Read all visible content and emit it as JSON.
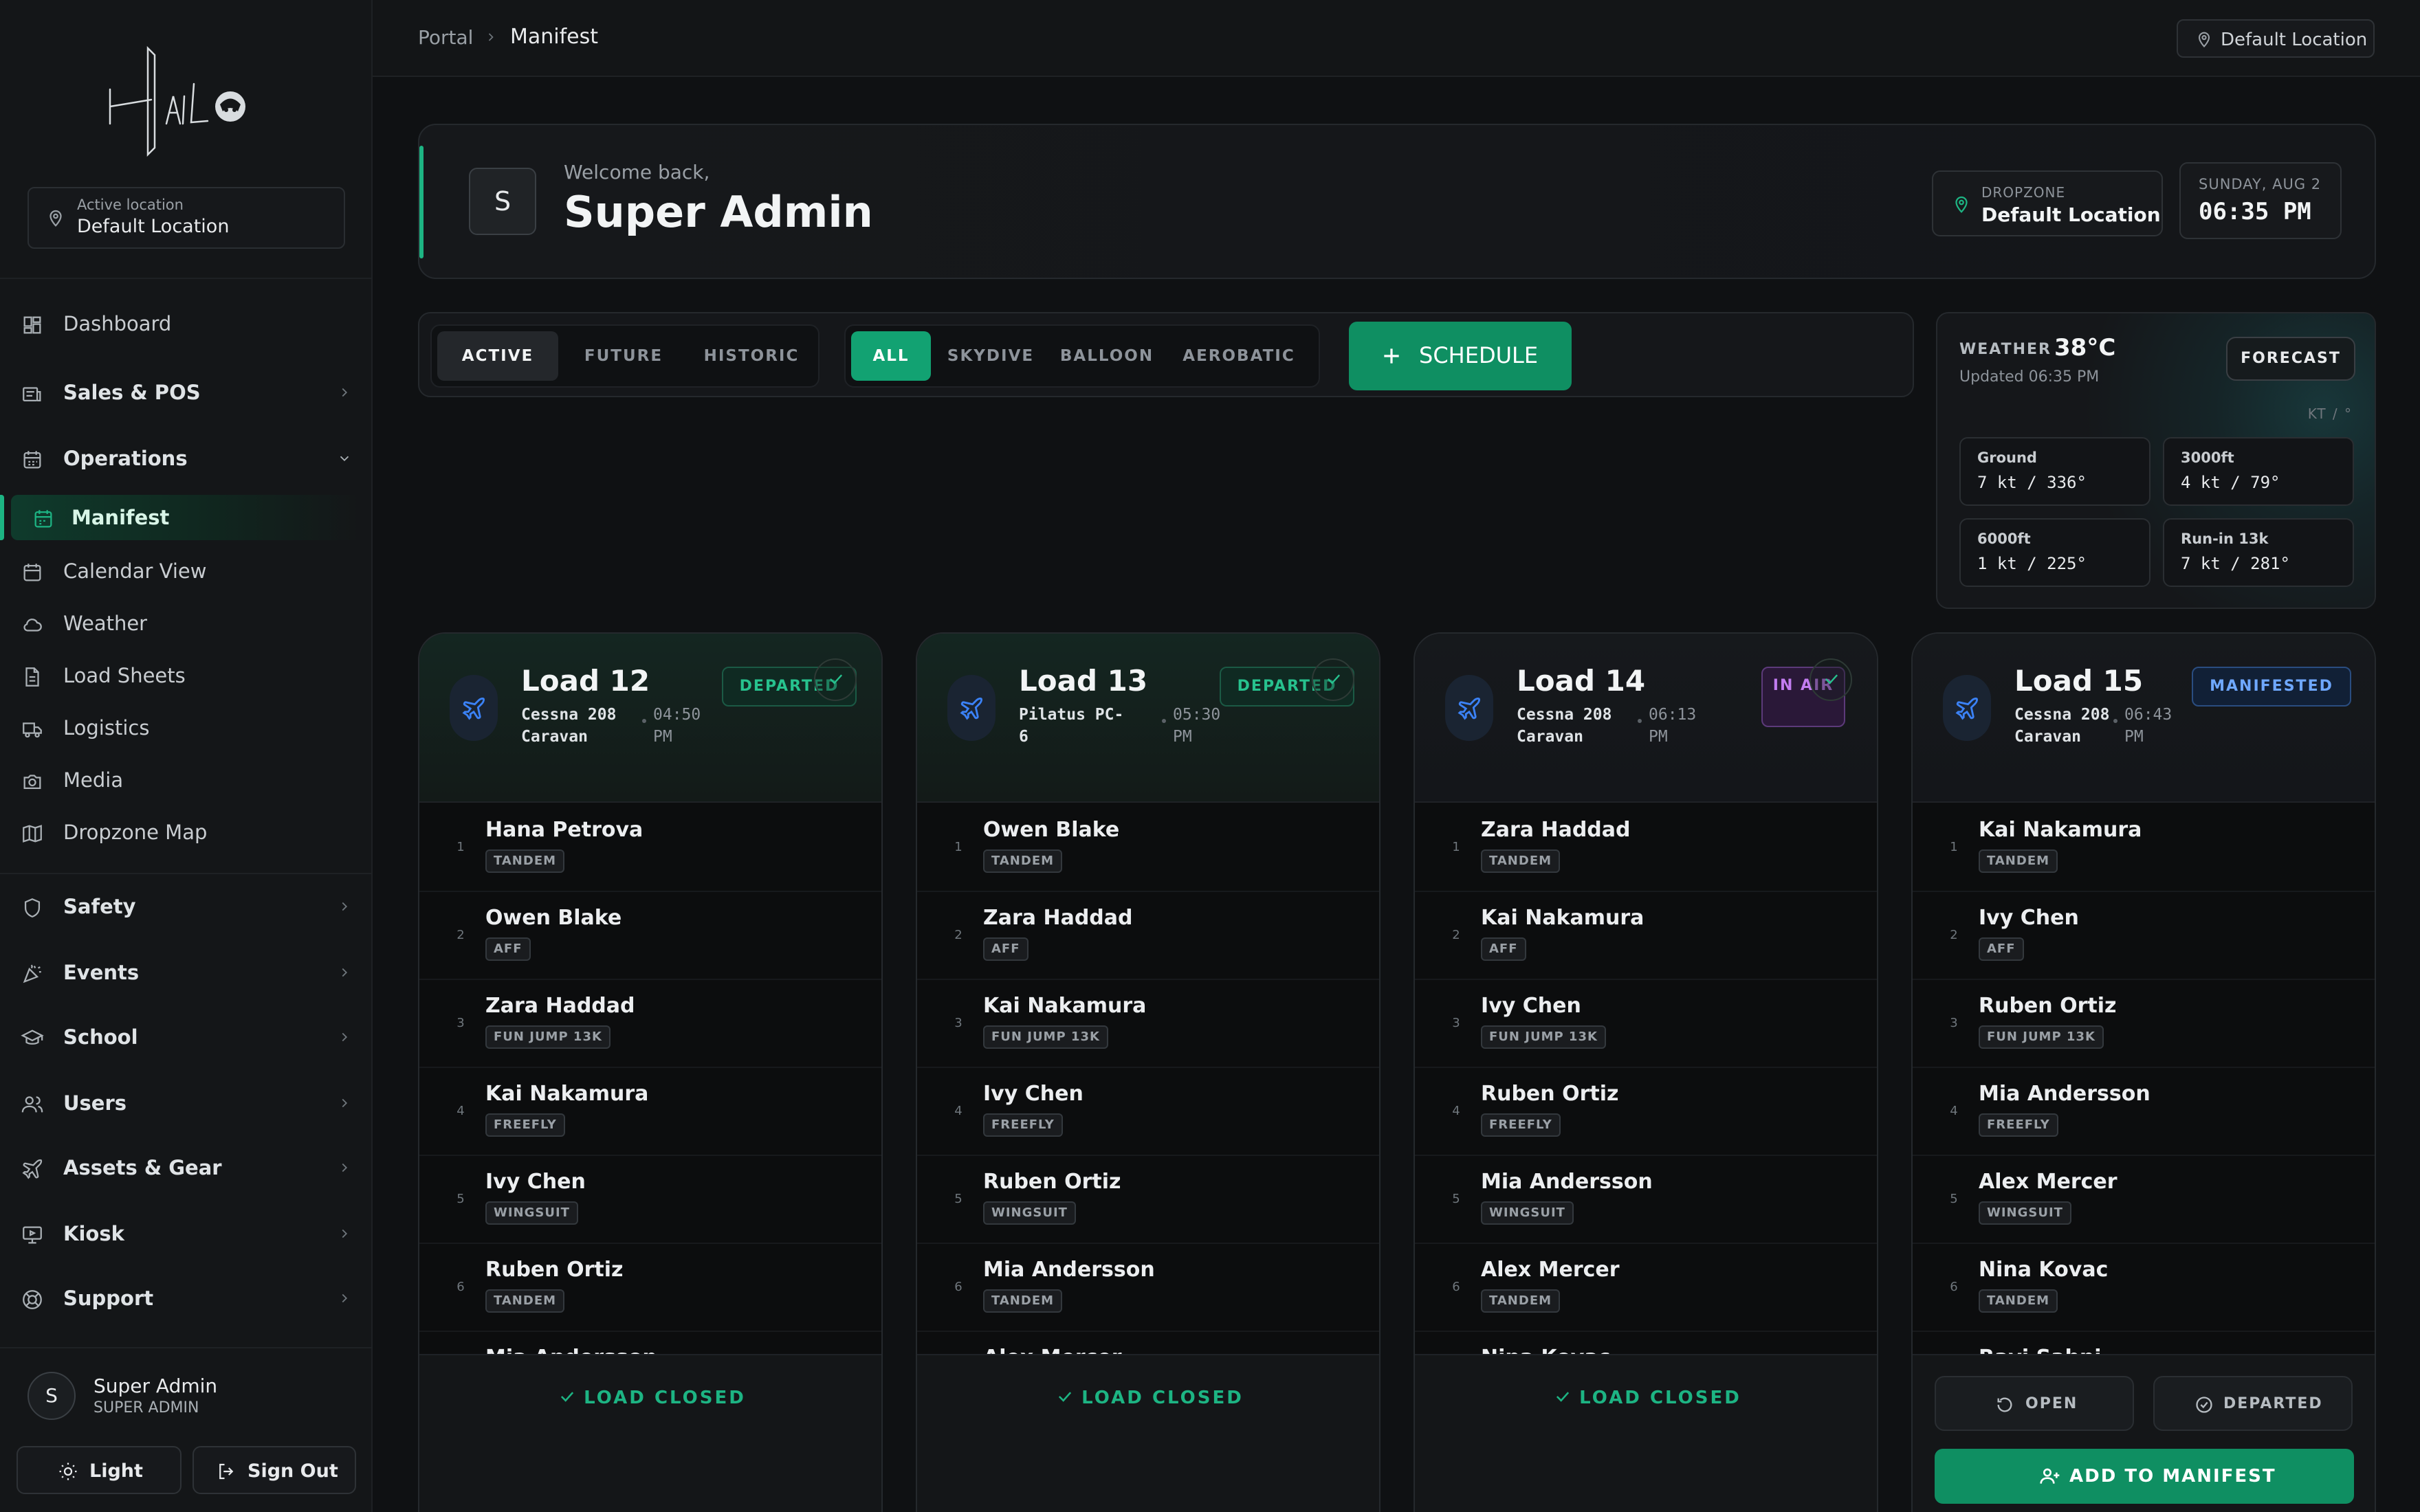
{
  "sidebar": {
    "active_location_label": "Active location",
    "active_location_value": "Default Location",
    "items": [
      {
        "label": "Dashboard",
        "icon": "dashboard-icon"
      },
      {
        "label": "Sales & POS",
        "icon": "receipt-icon"
      },
      {
        "label": "Operations",
        "icon": "calendar-icon"
      },
      {
        "label": "Manifest",
        "icon": "calendar-icon"
      },
      {
        "label": "Calendar View",
        "icon": "calendar-icon"
      },
      {
        "label": "Weather",
        "icon": "cloud-icon"
      },
      {
        "label": "Load Sheets",
        "icon": "document-icon"
      },
      {
        "label": "Logistics",
        "icon": "truck-icon"
      },
      {
        "label": "Media",
        "icon": "camera-icon"
      },
      {
        "label": "Dropzone Map",
        "icon": "map-icon"
      },
      {
        "label": "Safety",
        "icon": "shield-icon"
      },
      {
        "label": "Events",
        "icon": "party-icon"
      },
      {
        "label": "School",
        "icon": "graduation-cap-icon"
      },
      {
        "label": "Users",
        "icon": "users-icon"
      },
      {
        "label": "Assets & Gear",
        "icon": "plane-icon"
      },
      {
        "label": "Kiosk",
        "icon": "monitor-icon"
      },
      {
        "label": "Support",
        "icon": "lifebuoy-icon"
      }
    ],
    "user": {
      "initial": "S",
      "name": "Super Admin",
      "role": "SUPER ADMIN"
    },
    "light_label": "Light",
    "signout_label": "Sign Out"
  },
  "topbar": {
    "crumb_root": "Portal",
    "crumb_current": "Manifest",
    "location": "Default Location"
  },
  "welcome": {
    "initial": "S",
    "greeting": "Welcome back,",
    "name": "Super Admin",
    "dropzone_label": "DROPZONE",
    "dropzone_value": "Default Location",
    "date": "SUNDAY, AUG 2",
    "time": "06:35 PM"
  },
  "filters": {
    "time_tabs": [
      "ACTIVE",
      "FUTURE",
      "HISTORIC"
    ],
    "type_tabs": [
      "ALL",
      "SKYDIVE",
      "BALLOON",
      "AEROBATIC"
    ],
    "schedule_label": "SCHEDULE"
  },
  "weather": {
    "label": "WEATHER",
    "temp": "38°C",
    "updated": "Updated 06:35 PM",
    "forecast_label": "FORECAST",
    "unit": "KT / °",
    "cells": [
      {
        "name": "Ground",
        "value": "7 kt / 336°"
      },
      {
        "name": "3000ft",
        "value": "4 kt / 79°"
      },
      {
        "name": "6000ft",
        "value": "1 kt / 225°"
      },
      {
        "name": "Run-in 13k",
        "value": "7 kt / 281°"
      }
    ]
  },
  "loads": [
    {
      "title": "Load 12",
      "aircraft": "Cessna 208 Caravan",
      "time": "04:50 PM",
      "status": "DEPARTED",
      "pax": [
        {
          "name": "Hana Petrova",
          "tag": "TANDEM"
        },
        {
          "name": "Owen Blake",
          "tag": "AFF"
        },
        {
          "name": "Zara Haddad",
          "tag": "FUN JUMP 13K"
        },
        {
          "name": "Kai Nakamura",
          "tag": "FREEFLY"
        },
        {
          "name": "Ivy Chen",
          "tag": "WINGSUIT"
        },
        {
          "name": "Ruben Ortiz",
          "tag": "TANDEM"
        },
        {
          "name": "Mia Andersson",
          "tag": ""
        }
      ],
      "footer": "LOAD CLOSED"
    },
    {
      "title": "Load 13",
      "aircraft": "Pilatus PC-6",
      "time": "05:30 PM",
      "status": "DEPARTED",
      "pax": [
        {
          "name": "Owen Blake",
          "tag": "TANDEM"
        },
        {
          "name": "Zara Haddad",
          "tag": "AFF"
        },
        {
          "name": "Kai Nakamura",
          "tag": "FUN JUMP 13K"
        },
        {
          "name": "Ivy Chen",
          "tag": "FREEFLY"
        },
        {
          "name": "Ruben Ortiz",
          "tag": "WINGSUIT"
        },
        {
          "name": "Mia Andersson",
          "tag": "TANDEM"
        },
        {
          "name": "Alex Mercer",
          "tag": ""
        }
      ],
      "footer": "LOAD CLOSED"
    },
    {
      "title": "Load 14",
      "aircraft": "Cessna 208 Caravan",
      "time": "06:13 PM",
      "status": "IN AIR",
      "pax": [
        {
          "name": "Zara Haddad",
          "tag": "TANDEM"
        },
        {
          "name": "Kai Nakamura",
          "tag": "AFF"
        },
        {
          "name": "Ivy Chen",
          "tag": "FUN JUMP 13K"
        },
        {
          "name": "Ruben Ortiz",
          "tag": "FREEFLY"
        },
        {
          "name": "Mia Andersson",
          "tag": "WINGSUIT"
        },
        {
          "name": "Alex Mercer",
          "tag": "TANDEM"
        },
        {
          "name": "Nina Kovac",
          "tag": ""
        }
      ],
      "footer": "LOAD CLOSED"
    },
    {
      "title": "Load 15",
      "aircraft": "Cessna 208 Caravan",
      "time": "06:43 PM",
      "status": "MANIFESTED",
      "pax": [
        {
          "name": "Kai Nakamura",
          "tag": "TANDEM"
        },
        {
          "name": "Ivy Chen",
          "tag": "AFF"
        },
        {
          "name": "Ruben Ortiz",
          "tag": "FUN JUMP 13K"
        },
        {
          "name": "Mia Andersson",
          "tag": "FREEFLY"
        },
        {
          "name": "Alex Mercer",
          "tag": "WINGSUIT"
        },
        {
          "name": "Nina Kovac",
          "tag": "TANDEM"
        },
        {
          "name": "Ravi Sahni",
          "tag": ""
        }
      ],
      "open_label": "OPEN",
      "departed_label": "DEPARTED",
      "add_label": "ADD TO MANIFEST"
    }
  ],
  "colors": {
    "accent_green": "#1db483",
    "button_green": "#0f8f62",
    "departed": "#27c28e",
    "in_air": "#c27cf0",
    "manifested": "#6fa8ff",
    "plane_blue": "#3b82f6"
  }
}
